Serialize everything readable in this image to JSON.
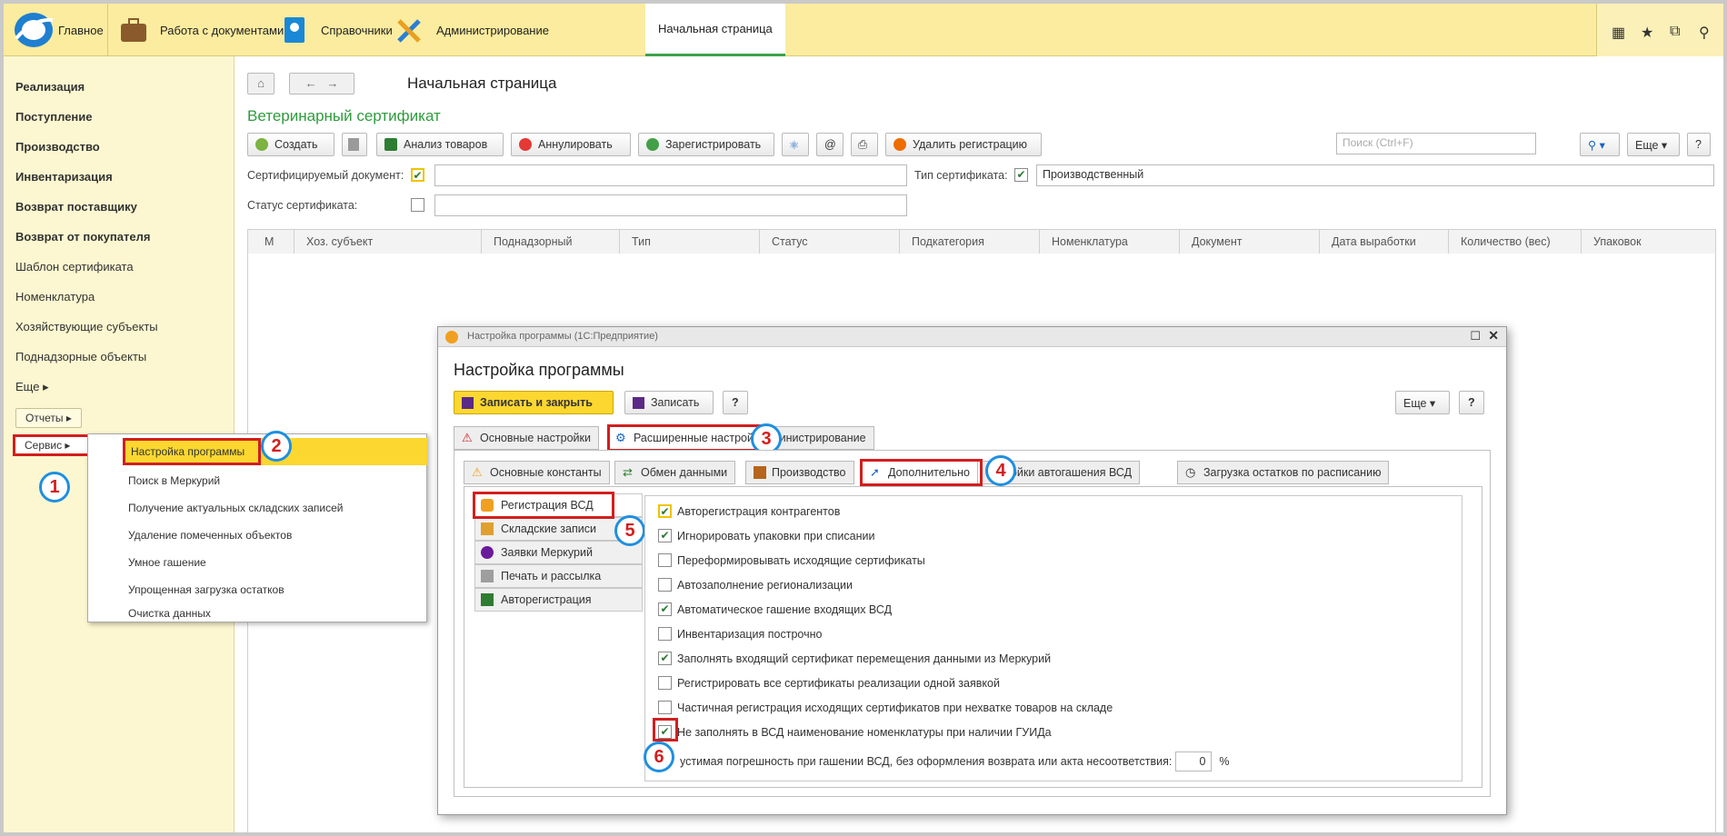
{
  "topbar": {
    "sections": [
      {
        "label": "Главное",
        "icon": "logo-1c-icon"
      },
      {
        "label": "Работа с документами",
        "icon": "briefcase-icon"
      },
      {
        "label": "Справочники",
        "icon": "address-book-icon"
      },
      {
        "label": "Администрирование",
        "icon": "tools-icon"
      },
      {
        "label": "Начальная страница",
        "icon": ""
      }
    ],
    "right_icons": [
      "apps-grid-icon",
      "star-icon",
      "history-icon",
      "search-icon"
    ]
  },
  "sidebar": {
    "items": [
      {
        "label": "Реализация"
      },
      {
        "label": "Поступление"
      },
      {
        "label": "Производство"
      },
      {
        "label": "Инвентаризация"
      },
      {
        "label": "Возврат поставщику"
      },
      {
        "label": "Возврат от покупателя"
      },
      {
        "label": "Шаблон сертификата"
      },
      {
        "label": "Номенклатура"
      },
      {
        "label": "Хозяйствующие субъекты"
      },
      {
        "label": "Поднадзорные объекты"
      },
      {
        "label": "Еще ▸"
      }
    ],
    "reports_button": "Отчеты ▸",
    "service_button": "Сервис ▸"
  },
  "service_menu": {
    "items": [
      {
        "label": "Настройка программы"
      },
      {
        "label": "Поиск в Меркурий"
      },
      {
        "label": "Получение актуальных складских записей"
      },
      {
        "label": "Удаление помеченных объектов"
      },
      {
        "label": "Умное гашение"
      },
      {
        "label": "Упрощенная загрузка остатков"
      },
      {
        "label": "Очистка данных"
      }
    ]
  },
  "main": {
    "page_title": "Начальная страница",
    "doc_title": "Ветеринарный сертификат",
    "toolbar": {
      "create": "Создать",
      "analyze": "Анализ товаров",
      "cancel": "Аннулировать",
      "register": "Зарегистрировать",
      "at": "@",
      "delete_reg": "Удалить регистрацию",
      "search_placeholder": "Поиск (Ctrl+F)",
      "more": "Еще ▾",
      "help": "?"
    },
    "filters": {
      "doc_label": "Сертифицируемый документ:",
      "type_label": "Тип сертификата:",
      "type_value": "Производственный",
      "status_label": "Статус сертификата:"
    },
    "columns": [
      "М",
      "Хоз. субъект",
      "Поднадзорный",
      "Тип",
      "Статус",
      "Подкатегория",
      "Номенклатура",
      "Документ",
      "Дата выработки",
      "Количество (вес)",
      "Упаковок"
    ]
  },
  "dialog": {
    "titlebar": "Настройка программы (1С:Предприятие)",
    "heading": "Настройка программы",
    "save_close": "Записать и закрыть",
    "save": "Записать",
    "help": "?",
    "more": "Еще ▾",
    "tabs1": [
      "Основные настройки",
      "Расширенные настройки",
      "министрирование"
    ],
    "tabs2": [
      "Основные константы",
      "Обмен данными",
      "Производство",
      "Дополнительно",
      "стройки автогашения ВСД",
      "Загрузка остатков по расписанию"
    ],
    "side_list": [
      "Регистрация ВСД",
      "Складские записи",
      "Заявки Меркурий",
      "Печать и рассылка",
      "Авторегистрация"
    ],
    "options": [
      {
        "label": "Авторегистрация контрагентов",
        "checked": true
      },
      {
        "label": "Игнорировать упаковки при списании",
        "checked": true
      },
      {
        "label": "Переформировывать исходящие сертификаты",
        "checked": false
      },
      {
        "label": "Автозаполнение регионализации",
        "checked": false
      },
      {
        "label": "Автоматическое гашение входящих ВСД",
        "checked": true
      },
      {
        "label": "Инвентаризация построчно",
        "checked": false
      },
      {
        "label": "Заполнять входящий сертификат перемещения данными из Меркурий",
        "checked": true
      },
      {
        "label": "Регистрировать все сертификаты реализации одной заявкой",
        "checked": false
      },
      {
        "label": "Частичная регистрация исходящих сертификатов при нехватке товаров на складе",
        "checked": false
      },
      {
        "label": "Не заполнять в ВСД наименование номенклатуры при наличии ГУИДа",
        "checked": true
      }
    ],
    "tolerance_label": "устимая погрешность при гашении ВСД, без оформления возврата или акта несоответствия:",
    "tolerance_value": "0",
    "tolerance_unit": "%"
  },
  "badges": [
    "1",
    "2",
    "3",
    "4",
    "5",
    "6"
  ],
  "colors": {
    "accent_green": "#2d9c3c",
    "highlight_yellow": "#fbd72f",
    "marker_red": "#d21e1e",
    "badge_blue": "#1f8fe0",
    "topbar": "#fbec9f"
  }
}
